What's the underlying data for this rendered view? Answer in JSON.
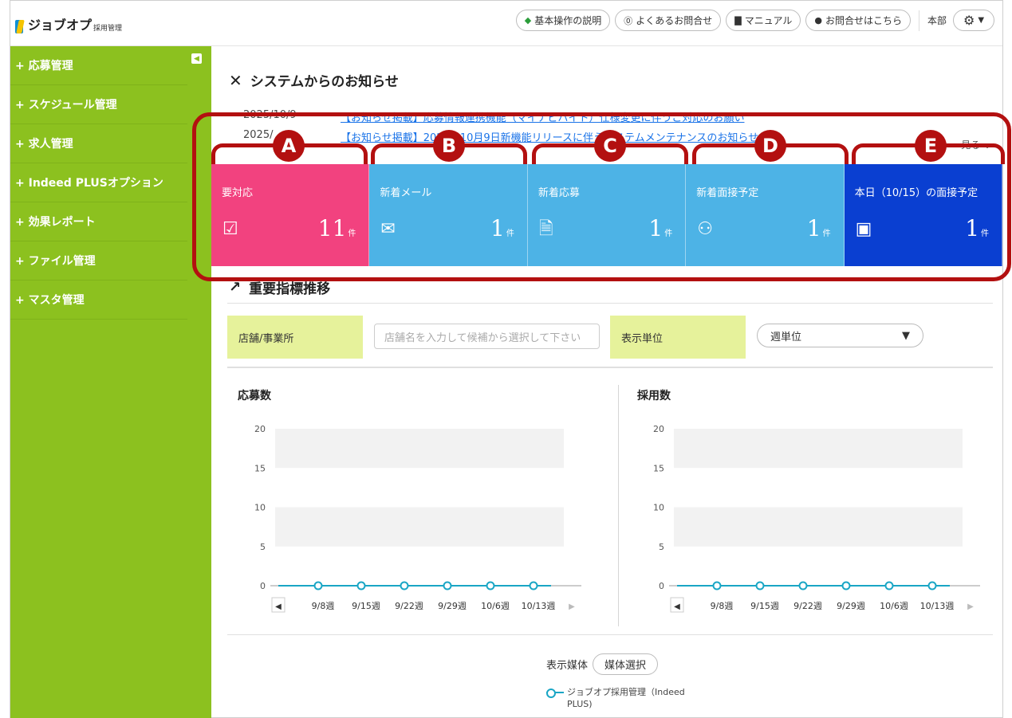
{
  "header": {
    "logo_text": "ジョブオプ",
    "logo_sub": "採用管理",
    "buttons": [
      "基本操作の説明",
      "よくあるお問合せ",
      "マニュアル",
      "お問合せはこちら"
    ],
    "store_label": "本部"
  },
  "sidebar": {
    "items": [
      {
        "label": "+ 応募管理"
      },
      {
        "label": "+ スケジュール管理"
      },
      {
        "label": "+ 求人管理"
      },
      {
        "label": "+ Indeed PLUSオプション"
      },
      {
        "label": "+ 効果レポート"
      },
      {
        "label": "+ ファイル管理"
      },
      {
        "label": "+ マスタ管理"
      }
    ]
  },
  "notices": {
    "title": "システムからのお知らせ",
    "items": [
      {
        "date": "2025/10/9",
        "text": "【お知らせ掲載】応募情報連携機能（マイナビバイト）仕様変更に伴うご対応のお願い"
      },
      {
        "date": "2025/",
        "text": "【お知らせ掲載】2025年10月9日新機能リリースに伴うシステムメンテナンスのお知らせ"
      }
    ],
    "more": "見る"
  },
  "cards": [
    {
      "title": "要対応",
      "value": "11",
      "unit": "件",
      "color": "#f2427f",
      "icon": "checkbox-icon"
    },
    {
      "title": "新着メール",
      "value": "1",
      "unit": "件",
      "color": "#4db3e6",
      "icon": "mail-icon"
    },
    {
      "title": "新着応募",
      "value": "1",
      "unit": "件",
      "color": "#4db3e6",
      "icon": "document-icon"
    },
    {
      "title": "新着面接予定",
      "value": "1",
      "unit": "件",
      "color": "#4db3e6",
      "icon": "people-icon"
    },
    {
      "title": "本日（10/15）の面接予定",
      "value": "1",
      "unit": "件",
      "color": "#0a3fd1",
      "icon": "calendar-icon"
    }
  ],
  "kpi": {
    "title": "重要指標推移",
    "store_label": "店舗/事業所",
    "store_placeholder": "店舗名を入力して候補から選択して下さい",
    "unit_label": "表示単位",
    "unit_value": "週単位",
    "media_label": "表示媒体",
    "media_button": "媒体選択",
    "legend": "ジョブオプ採用管理（Indeed PLUS)"
  },
  "annotation_labels": [
    "A",
    "B",
    "C",
    "D",
    "E"
  ],
  "chart_data": [
    {
      "type": "line",
      "title": "応募数",
      "categories": [
        "9/8週",
        "9/15週",
        "9/22週",
        "9/29週",
        "10/6週",
        "10/13週"
      ],
      "series": [
        {
          "name": "ジョブオプ採用管理（Indeed PLUS)",
          "values": [
            0,
            0,
            0,
            0,
            0,
            0
          ]
        }
      ],
      "yticks": [
        0,
        5,
        10,
        15,
        20
      ],
      "ylim": [
        0,
        20
      ]
    },
    {
      "type": "line",
      "title": "採用数",
      "categories": [
        "9/8週",
        "9/15週",
        "9/22週",
        "9/29週",
        "10/6週",
        "10/13週"
      ],
      "series": [
        {
          "name": "ジョブオプ採用管理（Indeed PLUS)",
          "values": [
            0,
            0,
            0,
            0,
            0,
            0
          ]
        }
      ],
      "yticks": [
        0,
        5,
        10,
        15,
        20
      ],
      "ylim": [
        0,
        20
      ]
    }
  ]
}
